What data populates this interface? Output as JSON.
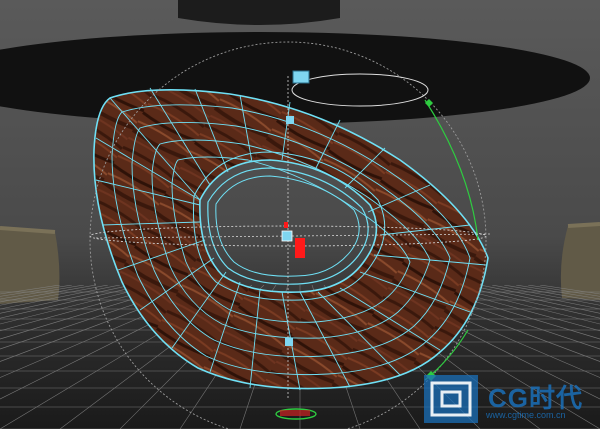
{
  "watermark": {
    "brand": "CG时代",
    "url": "www.cgtime.com.cn"
  },
  "scene": {
    "background_color": "#5c5c5c",
    "wood_base": "#5a2a18",
    "wireframe_color": "#6fe0f5",
    "manipulator_color": "#9a9a9a",
    "pivot_color": "#ff1a1a",
    "handle_color": "#7fd6f0",
    "rotate_green": "#2ecc40",
    "watermark_blue": "#1a6fb8"
  }
}
